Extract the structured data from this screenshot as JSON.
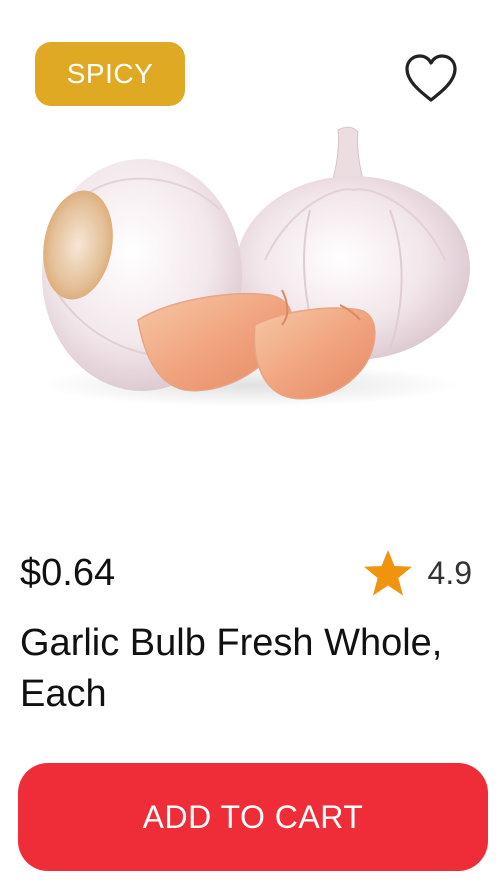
{
  "product": {
    "badge": "SPICY",
    "price": "$0.64",
    "rating": "4.9",
    "name": "Garlic Bulb Fresh Whole, Each",
    "image_subject": "garlic bulbs and cloves"
  },
  "actions": {
    "add_to_cart_label": "ADD TO CART",
    "favorite_icon": "heart-outline-icon"
  },
  "icons": {
    "rating": "star-icon"
  },
  "colors": {
    "badge": "#e0a923",
    "cta": "#ef2d38",
    "star": "#f0930d"
  }
}
